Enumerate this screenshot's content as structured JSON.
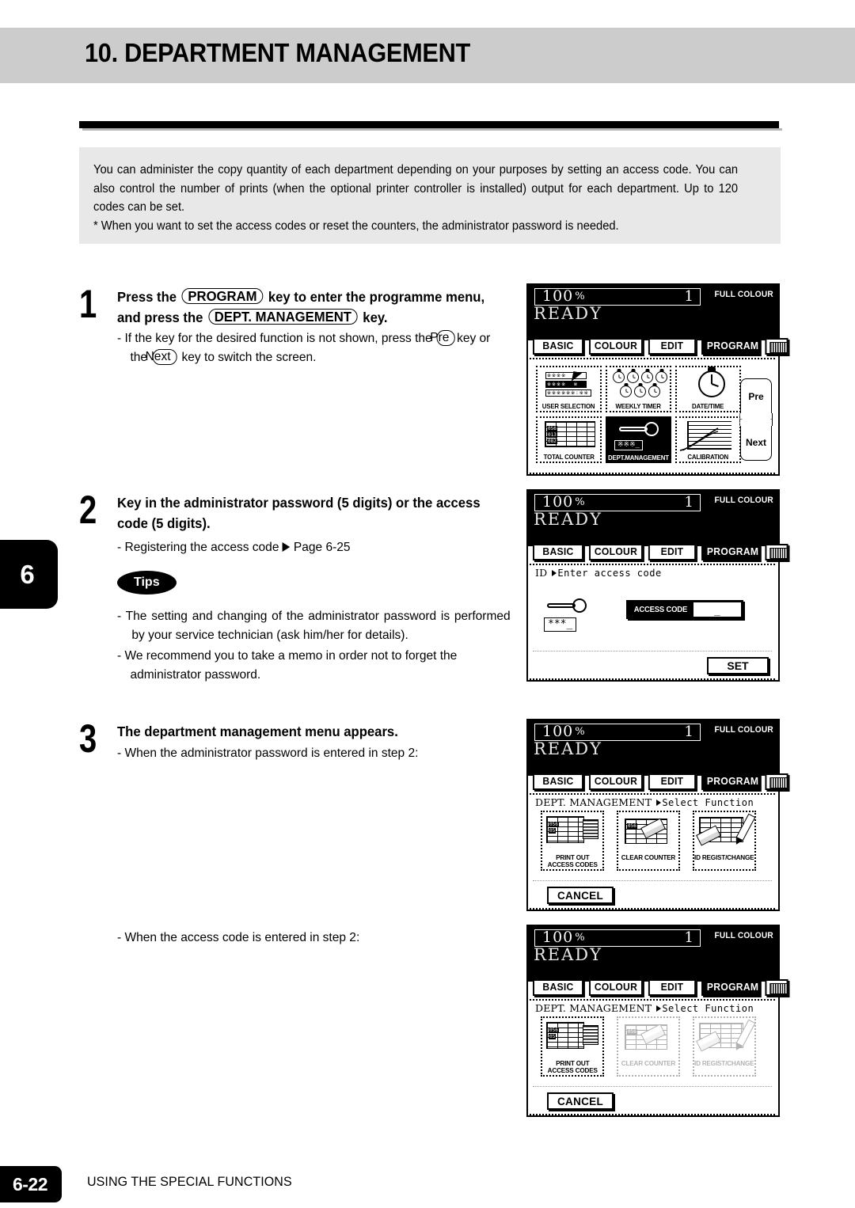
{
  "header": {
    "chapter_title": "10. DEPARTMENT MANAGEMENT"
  },
  "side_tab": {
    "chapter_number": "6"
  },
  "intro": {
    "line1": "You can administer the copy quantity of each department depending on your purposes by setting an access code. You can also control the number of  prints (when the optional printer controller is installed) output for each department.  Up to 120 codes can be set.",
    "line2": "*  When you want to set the access codes or reset the counters, the administrator password is needed."
  },
  "steps": [
    {
      "number": "1",
      "head_a": "Press the",
      "head_key1": "PROGRAM",
      "head_b": "key to enter the programme menu, and  press the",
      "head_key2": "DEPT. MANAGEMENT",
      "head_c": "key.",
      "sub_a": "- If the key for the desired function is not shown, press the",
      "sub_key1": "Pre",
      "sub_b": "key or the",
      "sub_key2": "Next",
      "sub_c": "key to switch the screen."
    },
    {
      "number": "2",
      "head": "Key in the administrator password (5 digits) or the access code (5 digits).",
      "sub_ref_a": "- Registering the access code",
      "sub_ref_b": "Page 6-25",
      "tips_label": "Tips",
      "tip1": "-  The setting and changing of the administrator password is performed by your service technician (ask him/her for details).",
      "tip2": "- We recommend you to take a memo in order not to forget the administrator password."
    },
    {
      "number": "3",
      "head": "The department management menu appears.",
      "sub1": "- When the administrator password is entered in step 2:",
      "sub2": "- When the access code is entered in step 2:"
    }
  ],
  "lcd_common": {
    "ratio": "100",
    "percent": "%",
    "copies": "1",
    "colour_mode": "FULL COLOUR",
    "ready": "READY",
    "tabs": [
      {
        "label": "BASIC",
        "selected": false
      },
      {
        "label": "COLOUR",
        "selected": false
      },
      {
        "label": "EDIT",
        "selected": false
      },
      {
        "label": "PROGRAM",
        "selected": true
      }
    ],
    "tab_icon": "keypad-icon"
  },
  "panel1": {
    "name": "programme-menu-screen",
    "functions": [
      {
        "label": "USER SELECTION",
        "icon": "user-selection-icon",
        "selected": false
      },
      {
        "label": "WEEKLY TIMER",
        "icon": "weekly-timer-icon",
        "selected": false
      },
      {
        "label": "DATE/TIME",
        "icon": "date-time-icon",
        "selected": false
      },
      {
        "label": "TOTAL COUNTER",
        "icon": "total-counter-icon",
        "selected": false
      },
      {
        "label": "DEPT.MANAGEMENT",
        "icon": "dept-management-icon",
        "selected": true
      },
      {
        "label": "CALIBRATION",
        "icon": "calibration-icon",
        "selected": false
      }
    ],
    "nav_prev": "Pre",
    "nav_next": "Next"
  },
  "panel2": {
    "name": "access-code-entry-screen",
    "status_label": "ID",
    "status_value": "Enter access code",
    "key_stars": "***_",
    "field_label": "ACCESS CODE",
    "field_value": "_",
    "set_button": "SET"
  },
  "panel3": {
    "name": "dept-management-menu-admin",
    "status_label": "DEPT. MANAGEMENT",
    "status_value": "Select Function",
    "functions": [
      {
        "label1": "PRINT OUT",
        "label2": "ACCESS CODES",
        "icon": "print-out-access-codes-icon",
        "enabled": true
      },
      {
        "label1": "CLEAR COUNTER",
        "label2": "",
        "icon": "clear-counter-icon",
        "enabled": true
      },
      {
        "label1": "ID REGIST/CHANGE",
        "label2": "",
        "icon": "id-regist-change-icon",
        "enabled": true
      }
    ],
    "cancel_button": "CANCEL"
  },
  "panel4": {
    "name": "dept-management-menu-user",
    "status_label": "DEPT. MANAGEMENT",
    "status_value": "Select Function",
    "functions": [
      {
        "label1": "PRINT OUT",
        "label2": "ACCESS CODES",
        "icon": "print-out-access-codes-icon",
        "enabled": true
      },
      {
        "label1": "CLEAR COUNTER",
        "label2": "",
        "icon": "clear-counter-icon",
        "enabled": false
      },
      {
        "label1": "ID REGIST/CHANGE",
        "label2": "",
        "icon": "id-regist-change-icon",
        "enabled": false
      }
    ],
    "cancel_button": "CANCEL"
  },
  "footer": {
    "page_number": "6-22",
    "section_title": "USING THE SPECIAL FUNCTIONS"
  }
}
